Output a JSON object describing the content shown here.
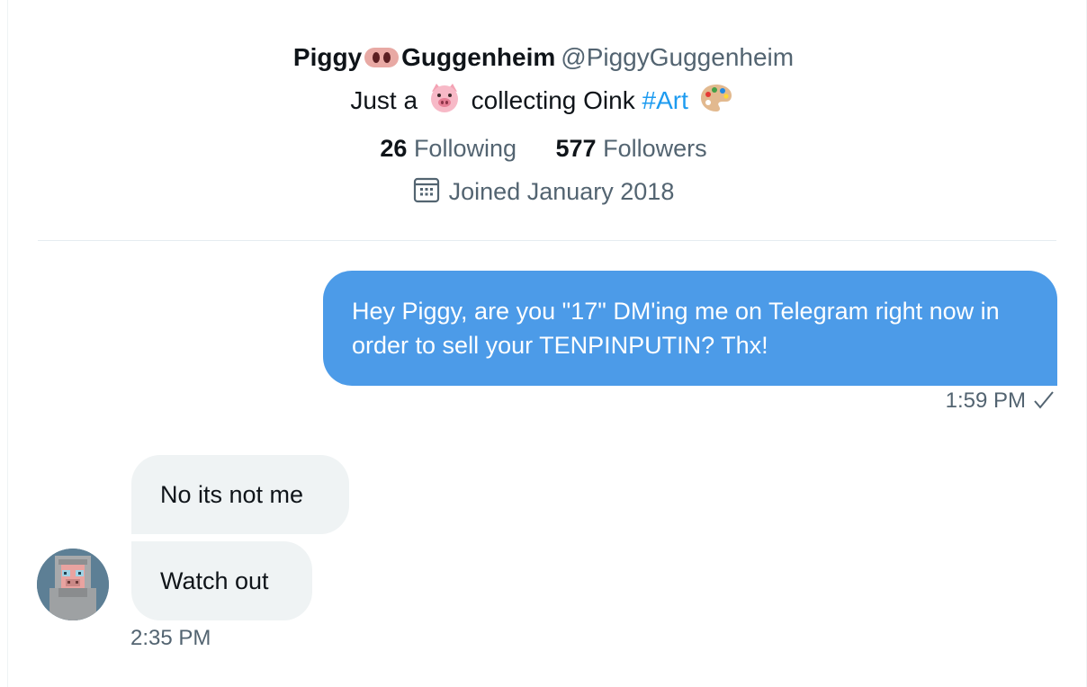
{
  "profile": {
    "name_part1": "Piggy",
    "name_part2": "Guggenheim",
    "handle": "@PiggyGuggenheim",
    "bio_prefix": "Just a",
    "bio_middle": "collecting Oink",
    "bio_hashtag": "#Art",
    "following_count": "26",
    "following_label": "Following",
    "followers_count": "577",
    "followers_label": "Followers",
    "joined": "Joined January 2018"
  },
  "messages": {
    "outgoing": {
      "text": "Hey Piggy, are you \"17\" DM'ing me on Telegram right now in order to sell your TENPINPUTIN? Thx!",
      "time": "1:59 PM"
    },
    "incoming": [
      {
        "text": "No its not me"
      },
      {
        "text": "Watch out"
      }
    ],
    "incoming_time": "2:35 PM"
  },
  "icons": {
    "name_emoji": "pig-nose-icon",
    "bio_emoji_1": "pig-face-icon",
    "bio_emoji_2": "palette-icon",
    "joined_icon": "calendar-icon",
    "sent_status": "check-icon"
  },
  "colors": {
    "accent": "#1d9bf0",
    "outgoing_bubble": "#4c9be8",
    "incoming_bubble": "#eff3f4",
    "secondary_text": "#536471"
  }
}
